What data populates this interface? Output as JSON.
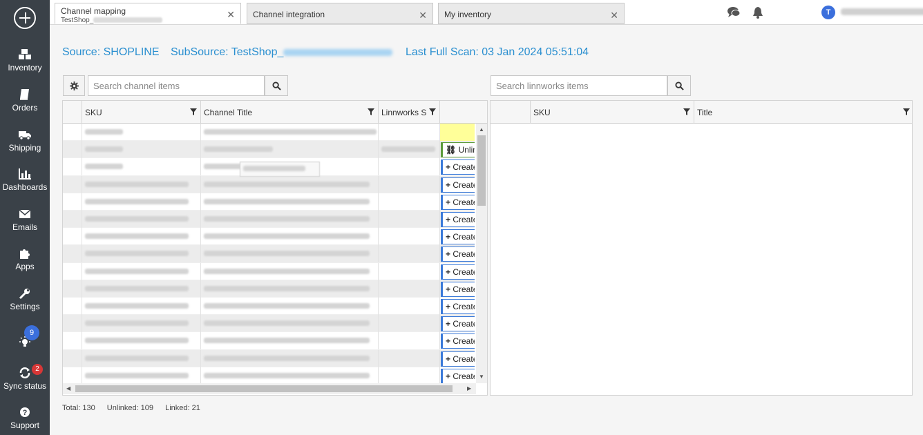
{
  "sidebar": {
    "items": [
      {
        "label": "Inventory",
        "icon": "cubes-icon"
      },
      {
        "label": "Orders",
        "icon": "book-icon"
      },
      {
        "label": "Shipping",
        "icon": "truck-icon"
      },
      {
        "label": "Dashboards",
        "icon": "bar-chart-icon"
      },
      {
        "label": "Emails",
        "icon": "envelope-icon"
      },
      {
        "label": "Apps",
        "icon": "puzzle-icon"
      },
      {
        "label": "Settings",
        "icon": "wrench-icon"
      },
      {
        "label": "",
        "icon": "lightbulb-icon",
        "badge": "9"
      },
      {
        "label": "Sync status",
        "icon": "sync-icon",
        "badge": "2"
      },
      {
        "label": "Support",
        "icon": "question-icon"
      }
    ]
  },
  "tabs": [
    {
      "title": "Channel mapping",
      "subtitle": "TestShop_",
      "active": true
    },
    {
      "title": "Channel integration",
      "active": false
    },
    {
      "title": "My inventory",
      "active": false
    }
  ],
  "user": {
    "initial": "T"
  },
  "header": {
    "source": "Source: SHOPLINE",
    "subsource_prefix": "SubSource: TestShop_",
    "last_scan": "Last Full Scan: 03 Jan 2024 05:51:04"
  },
  "left_panel": {
    "search_placeholder": "Search channel items",
    "columns": [
      "SKU",
      "Channel Title",
      "Linnworks S"
    ],
    "action_create": "Create",
    "action_unlink": "Unlink",
    "row_actions": [
      "none",
      "unlink",
      "create",
      "create",
      "create",
      "create",
      "create",
      "create",
      "create",
      "create",
      "create",
      "create",
      "create",
      "create",
      "create"
    ]
  },
  "right_panel": {
    "search_placeholder": "Search linnworks items",
    "columns": [
      "SKU",
      "Title"
    ]
  },
  "summary": {
    "total": "Total: 130",
    "unlinked": "Unlinked: 109",
    "linked": "Linked: 21"
  },
  "colors": {
    "sidebar": "#3a4148",
    "accent": "#2a8fd0",
    "create_border": "#3b7ad9",
    "unlink_border": "#5b9b3a",
    "badge_blue": "#3b6fdc",
    "badge_red": "#d73737"
  }
}
